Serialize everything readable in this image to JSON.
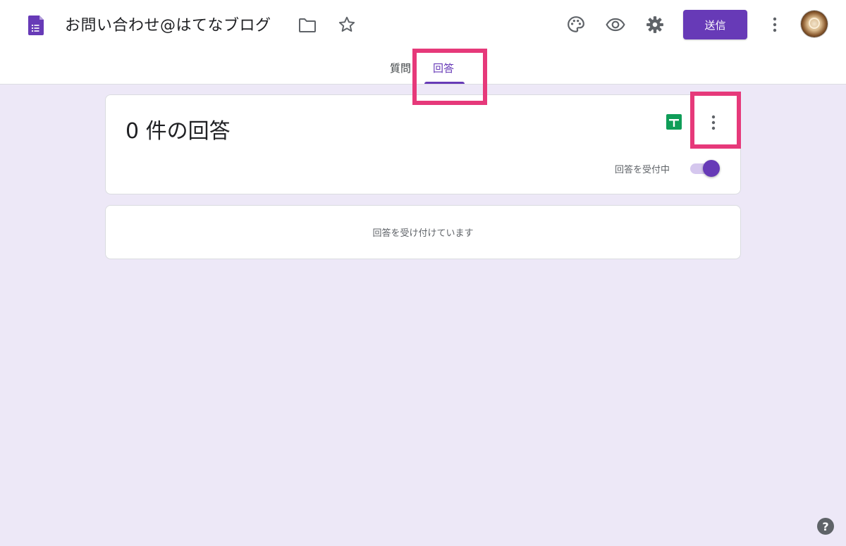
{
  "header": {
    "title": "お問い合わせ@はてなブログ",
    "send_label": "送信"
  },
  "icons": {
    "app": "forms-icon",
    "folder": "folder-icon",
    "star": "star-icon",
    "palette": "palette-icon",
    "preview": "eye-icon",
    "settings": "gear-icon",
    "more": "more-vert-icon",
    "sheets": "sheets-icon",
    "help": "help-icon"
  },
  "tabs": [
    {
      "label": "質問",
      "active": false
    },
    {
      "label": "回答",
      "active": true
    }
  ],
  "summary": {
    "count_text": "0 件の回答",
    "accepting_label": "回答を受付中",
    "accepting": true
  },
  "status": {
    "message": "回答を受け付けています"
  },
  "help": {
    "glyph": "?"
  },
  "colors": {
    "accent": "#673ab7",
    "background": "#ede8f7",
    "highlight": "#e6397a",
    "sheets_green": "#0f9d58"
  }
}
